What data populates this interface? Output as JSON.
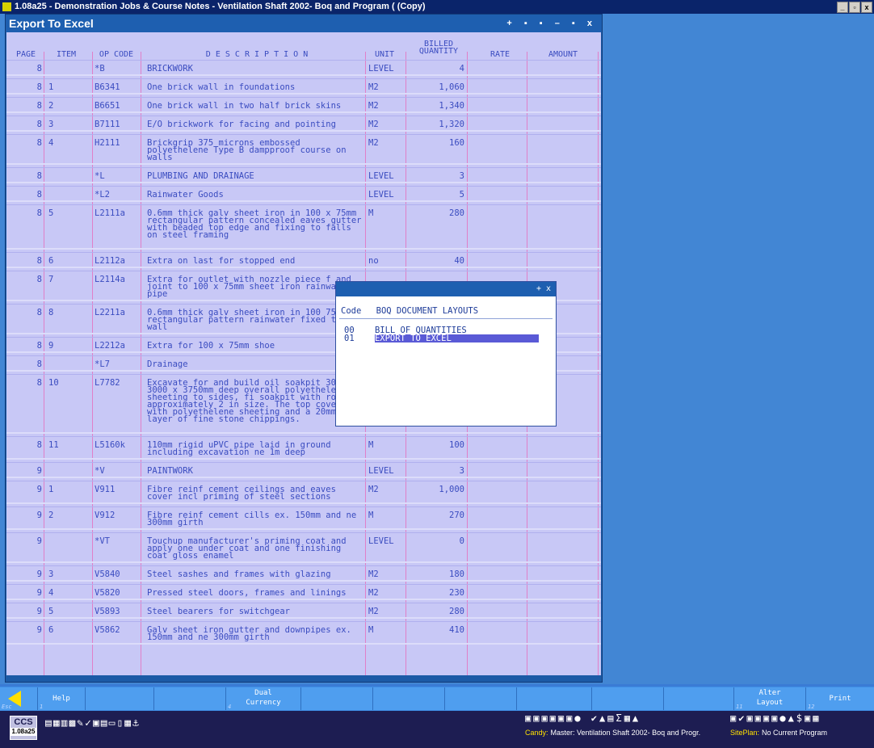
{
  "app": {
    "title": "1.08a25 - Demonstration Jobs & Course Notes - Ventilation Shaft 2002- Boq and Program ( (Copy)"
  },
  "window": {
    "title": "Export To Excel",
    "controls": "+ ▪ ▪ – ▪ x"
  },
  "columns": {
    "page": "PAGE",
    "item": "ITEM",
    "opcode": "OP CODE",
    "description": "D E S C R I P T I O N",
    "unit": "UNIT",
    "billed1": "BILLED",
    "billed2": "QUANTITY",
    "rate": "RATE",
    "amount": "AMOUNT"
  },
  "rows": [
    {
      "page": "8",
      "item": "",
      "op": "*B",
      "desc": "BRICKWORK",
      "unit": "LEVEL",
      "qty": "4",
      "lines": 1
    },
    {
      "page": "8",
      "item": "1",
      "op": "B6341",
      "desc": "One brick wall in foundations",
      "unit": "M2",
      "qty": "1,060",
      "lines": 1
    },
    {
      "page": "8",
      "item": "2",
      "op": "B6651",
      "desc": "One brick wall in two half brick skins",
      "unit": "M2",
      "qty": "1,340",
      "lines": 1
    },
    {
      "page": "8",
      "item": "3",
      "op": "B7111",
      "desc": "E/O brickwork for facing and pointing",
      "unit": "M2",
      "qty": "1,320",
      "lines": 1
    },
    {
      "page": "8",
      "item": "4",
      "op": "H2111",
      "desc": "Brickgrip 375 microns embossed polyethelene Type B dampproof course on walls",
      "unit": "M2",
      "qty": "160",
      "lines": 3
    },
    {
      "page": "8",
      "item": "",
      "op": "*L",
      "desc": "PLUMBING AND DRAINAGE",
      "unit": "LEVEL",
      "qty": "3",
      "lines": 1
    },
    {
      "page": "8",
      "item": "",
      "op": "*L2",
      "desc": "Rainwater Goods",
      "unit": "LEVEL",
      "qty": "5",
      "lines": 1
    },
    {
      "page": "8",
      "item": "5",
      "op": "L2111a",
      "desc": "0.6mm thick galv sheet iron in 100 x 75mm rectangular pattern concealed eaves gutter with beaded top edge and fixing to falls on steel framing",
      "unit": "M",
      "qty": "280",
      "lines": 5
    },
    {
      "page": "8",
      "item": "6",
      "op": "L2112a",
      "desc": "Extra on last for stopped end",
      "unit": "no",
      "qty": "40",
      "lines": 1
    },
    {
      "page": "8",
      "item": "7",
      "op": "L2114a",
      "desc": "Extra for outlet with nozzle piece f and joint to 100 x 75mm sheet iron rainwater pipe",
      "unit": "",
      "qty": "",
      "lines": 3
    },
    {
      "page": "8",
      "item": "8",
      "op": "L2211a",
      "desc": "0.6mm thick galv sheet iron in 100 75mm rectangular pattern rainwater fixed to wall",
      "unit": "",
      "qty": "",
      "lines": 3
    },
    {
      "page": "8",
      "item": "9",
      "op": "L2212a",
      "desc": "Extra for 100 x 75mm shoe",
      "unit": "",
      "qty": "",
      "lines": 1
    },
    {
      "page": "8",
      "item": "",
      "op": "*L7",
      "desc": "Drainage",
      "unit": "",
      "qty": "",
      "lines": 1
    },
    {
      "page": "8",
      "item": "10",
      "op": "L7782",
      "desc": "Excavate for and build oil soakpit 3000 x 3000 x 3750mm deep overall polyethelene sheeting to sides, fi soakpit with rocks approximately 2 in size. The top covered with polyethelene sheeting and a 20mm layer of fine stone chippings.",
      "unit": "",
      "qty": "",
      "lines": 7
    },
    {
      "page": "8",
      "item": "11",
      "op": "L5160k",
      "desc": "110mm rigid uPVC pipe laid in ground including excavation ne 1m deep",
      "unit": "M",
      "qty": "100",
      "lines": 2
    },
    {
      "page": "9",
      "item": "",
      "op": "*V",
      "desc": "PAINTWORK",
      "unit": "LEVEL",
      "qty": "3",
      "lines": 1
    },
    {
      "page": "9",
      "item": "1",
      "op": "V911",
      "desc": "Fibre reinf cement ceilings and eaves cover incl priming of steel sections",
      "unit": "M2",
      "qty": "1,000",
      "lines": 2
    },
    {
      "page": "9",
      "item": "2",
      "op": "V912",
      "desc": "Fibre reinf cement cills ex. 150mm and ne 300mm girth",
      "unit": "M",
      "qty": "270",
      "lines": 2
    },
    {
      "page": "9",
      "item": "",
      "op": "*VT",
      "desc": "Touchup manufacturer's priming coat and apply one under coat and one finishing coat gloss enamel",
      "unit": "LEVEL",
      "qty": "0",
      "lines": 3
    },
    {
      "page": "9",
      "item": "3",
      "op": "V5840",
      "desc": "Steel sashes and frames with glazing",
      "unit": "M2",
      "qty": "180",
      "lines": 1
    },
    {
      "page": "9",
      "item": "4",
      "op": "V5820",
      "desc": "Pressed steel doors, frames and linings",
      "unit": "M2",
      "qty": "230",
      "lines": 1
    },
    {
      "page": "9",
      "item": "5",
      "op": "V5893",
      "desc": "Steel bearers for switchgear",
      "unit": "M2",
      "qty": "280",
      "lines": 1
    },
    {
      "page": "9",
      "item": "6",
      "op": "V5862",
      "desc": "Galv sheet iron gutter and downpipes ex. 150mm and ne 300mm girth",
      "unit": "M",
      "qty": "410",
      "lines": 2
    }
  ],
  "popup": {
    "controls": "+ x",
    "code_header": "Code",
    "layouts_header": "BOQ DOCUMENT LAYOUTS",
    "items": [
      {
        "code": "00",
        "label": "BILL OF QUANTITIES"
      },
      {
        "code": "01",
        "label": "EXPORT TO EXCEL"
      }
    ]
  },
  "fkeys": {
    "esc": "Esc",
    "help": "Help",
    "help_num": "1",
    "dual1": "Dual",
    "dual2": "Currency",
    "dual_num": "4",
    "alter1": "Alter",
    "alter2": "Layout",
    "alter_num": "11",
    "print": "Print",
    "print_num": "12"
  },
  "taskbar": {
    "logo_text": "CCS",
    "version": "1.08a25",
    "candy_label": "Candy:",
    "candy_text": "Master: Ventilation Shaft 2002- Boq and Progr.",
    "siteplan_label": "SitePlan:",
    "siteplan_text": "No Current Program"
  }
}
